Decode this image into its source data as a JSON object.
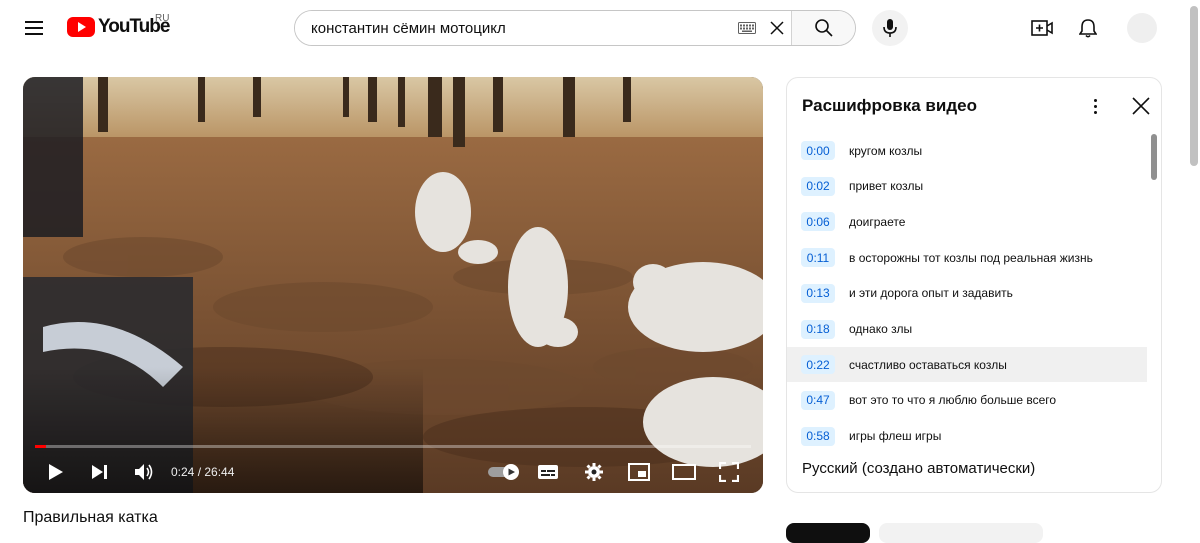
{
  "header": {
    "logo_text": "YouTube",
    "country_code": "RU",
    "search_value": "константин сёмин мотоцикл"
  },
  "player": {
    "current_time": "0:24",
    "duration": "26:44",
    "time_display": "0:24 / 26:44",
    "progress_fraction": 0.015
  },
  "video": {
    "title": "Правильная катка"
  },
  "transcript": {
    "title": "Расшифровка видео",
    "language": "Русский (создано автоматически)",
    "active_index": 6,
    "segments": [
      {
        "time": "0:00",
        "text": "кругом козлы"
      },
      {
        "time": "0:02",
        "text": "привет козлы"
      },
      {
        "time": "0:06",
        "text": "доиграете"
      },
      {
        "time": "0:11",
        "text": "в осторожны тот козлы под реальная жизнь"
      },
      {
        "time": "0:13",
        "text": "и эти дорога опыт и задавить"
      },
      {
        "time": "0:18",
        "text": "однако злы"
      },
      {
        "time": "0:22",
        "text": "счастливо оставаться козлы"
      },
      {
        "time": "0:47",
        "text": "вот это то что я люблю больше всего"
      },
      {
        "time": "0:58",
        "text": "игры флеш игры"
      }
    ]
  },
  "colors": {
    "brand_red": "#ff0000",
    "timestamp_blue": "#065fd4",
    "timestamp_bg": "#def1ff"
  }
}
